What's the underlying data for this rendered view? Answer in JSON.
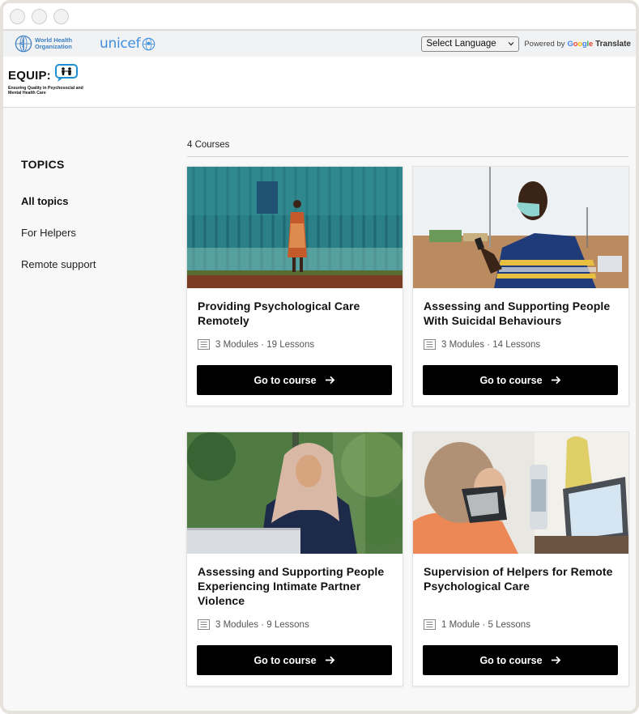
{
  "header": {
    "who_logo_text": "World Health Organization",
    "unicef_logo_text": "unicef",
    "language_select": "Select Language",
    "powered_by": "Powered by",
    "google": [
      "G",
      "o",
      "o",
      "g",
      "l",
      "e"
    ],
    "translate": "Translate",
    "brand_name": "EQUIP:",
    "brand_tagline": "Ensuring Quality in Psychosocial and Mental Health Care"
  },
  "sidebar": {
    "heading": "TOPICS",
    "items": [
      {
        "label": "All topics",
        "active": true
      },
      {
        "label": "For Helpers",
        "active": false
      },
      {
        "label": "Remote support",
        "active": false
      }
    ]
  },
  "course_count": "4 Courses",
  "courses": [
    {
      "title": "Providing Psychological Care Remotely",
      "meta": "3 Modules · 19 Lessons",
      "button": "Go to course",
      "image": "woman standing by teal corrugated wall"
    },
    {
      "title": "Assessing and Supporting People With Suicidal Behaviours",
      "meta": "3 Modules · 14 Lessons",
      "button": "Go to course",
      "image": "man with face mask looking at phone"
    },
    {
      "title": "Assessing and Supporting People Experiencing Intimate Partner Violence",
      "meta": "3 Modules · 9 Lessons",
      "button": "Go to course",
      "image": "woman in headscarf using laptop"
    },
    {
      "title": "Supervision of Helpers for Remote Psychological Care",
      "meta": "1 Module · 5 Lessons",
      "button": "Go to course",
      "image": "woman on phone at desk with laptop"
    }
  ],
  "colors": {
    "button_bg": "#000000",
    "page_bg": "#f8f8f8",
    "who_blue": "#3d7fc2",
    "unicef_blue": "#3f8fe0"
  }
}
